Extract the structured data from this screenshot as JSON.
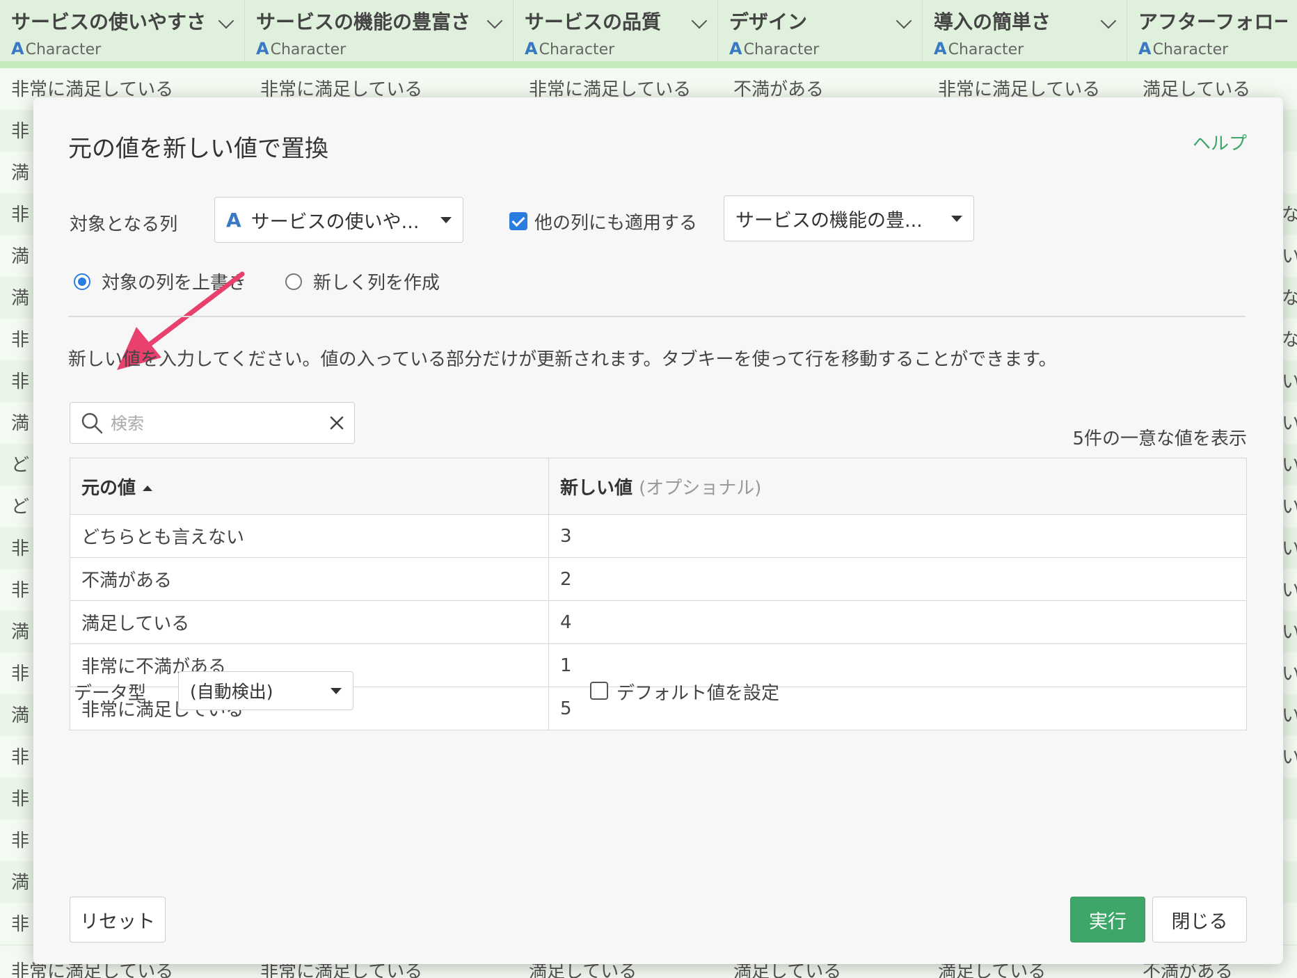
{
  "grid": {
    "columns": [
      {
        "title": "サービスの使いやすさ",
        "type": "Character"
      },
      {
        "title": "サービスの機能の豊富さ",
        "type": "Character"
      },
      {
        "title": "サービスの品質",
        "type": "Character"
      },
      {
        "title": "デザイン",
        "type": "Character"
      },
      {
        "title": "導入の簡単さ",
        "type": "Character"
      },
      {
        "title": "アフターフォロー",
        "type": "Character"
      }
    ],
    "first_row": [
      "非常に満足している",
      "非常に満足している",
      "非常に満足している",
      "不満がある",
      "非常に満足している",
      "満足している"
    ],
    "left_cells": [
      "非",
      "満",
      "非",
      "満",
      "満",
      "非",
      "非",
      "満",
      "ど",
      "ど",
      "非",
      "非",
      "満",
      "非",
      "満",
      "非",
      "非",
      "非",
      "満",
      "非"
    ],
    "right_cells": [
      "な",
      "い",
      "な",
      "な",
      "い",
      "い",
      "い",
      "い",
      "い",
      "い",
      "い",
      "い",
      "い",
      "い"
    ],
    "last_row": [
      "非常に満足している",
      "非常に満足している",
      "満足している",
      "満足している",
      "満足している",
      "不満がある"
    ]
  },
  "dialog": {
    "title": "元の値を新しい値で置換",
    "help": "ヘルプ",
    "target_column_label": "対象となる列",
    "target_column_value": "サービスの使いや...",
    "apply_other_label": "他の列にも適用する",
    "apply_other_checked": true,
    "other_columns_value": "サービスの機能の豊...",
    "radio_overwrite": "対象の列を上書き",
    "radio_new": "新しく列を作成",
    "selected_mode": "overwrite",
    "instructions": "新しい値を入力してください。値の入っている部分だけが更新されます。タブキーを使って行を移動することができます。",
    "search_placeholder": "検索",
    "unique_count": "5件の一意な値を表示",
    "table": {
      "header_original": "元の値",
      "header_new": "新しい値",
      "header_new_optional": "(オプショナル)",
      "rows": [
        {
          "original": "どちらとも言えない",
          "new": "3"
        },
        {
          "original": "不満がある",
          "new": "2"
        },
        {
          "original": "満足している",
          "new": "4"
        },
        {
          "original": "非常に不満がある",
          "new": "1"
        },
        {
          "original": "非常に満足している",
          "new": "5"
        }
      ]
    },
    "data_type_label": "データ型",
    "data_type_value": "(自動検出)",
    "default_value_label": "デフォルト値を設定",
    "default_value_checked": false,
    "reset": "リセット",
    "run": "実行",
    "close": "閉じる"
  },
  "colors": {
    "primary": "#3fa66a",
    "accent_blue": "#2b7ce0",
    "annotation_arrow": "#e8416d"
  }
}
